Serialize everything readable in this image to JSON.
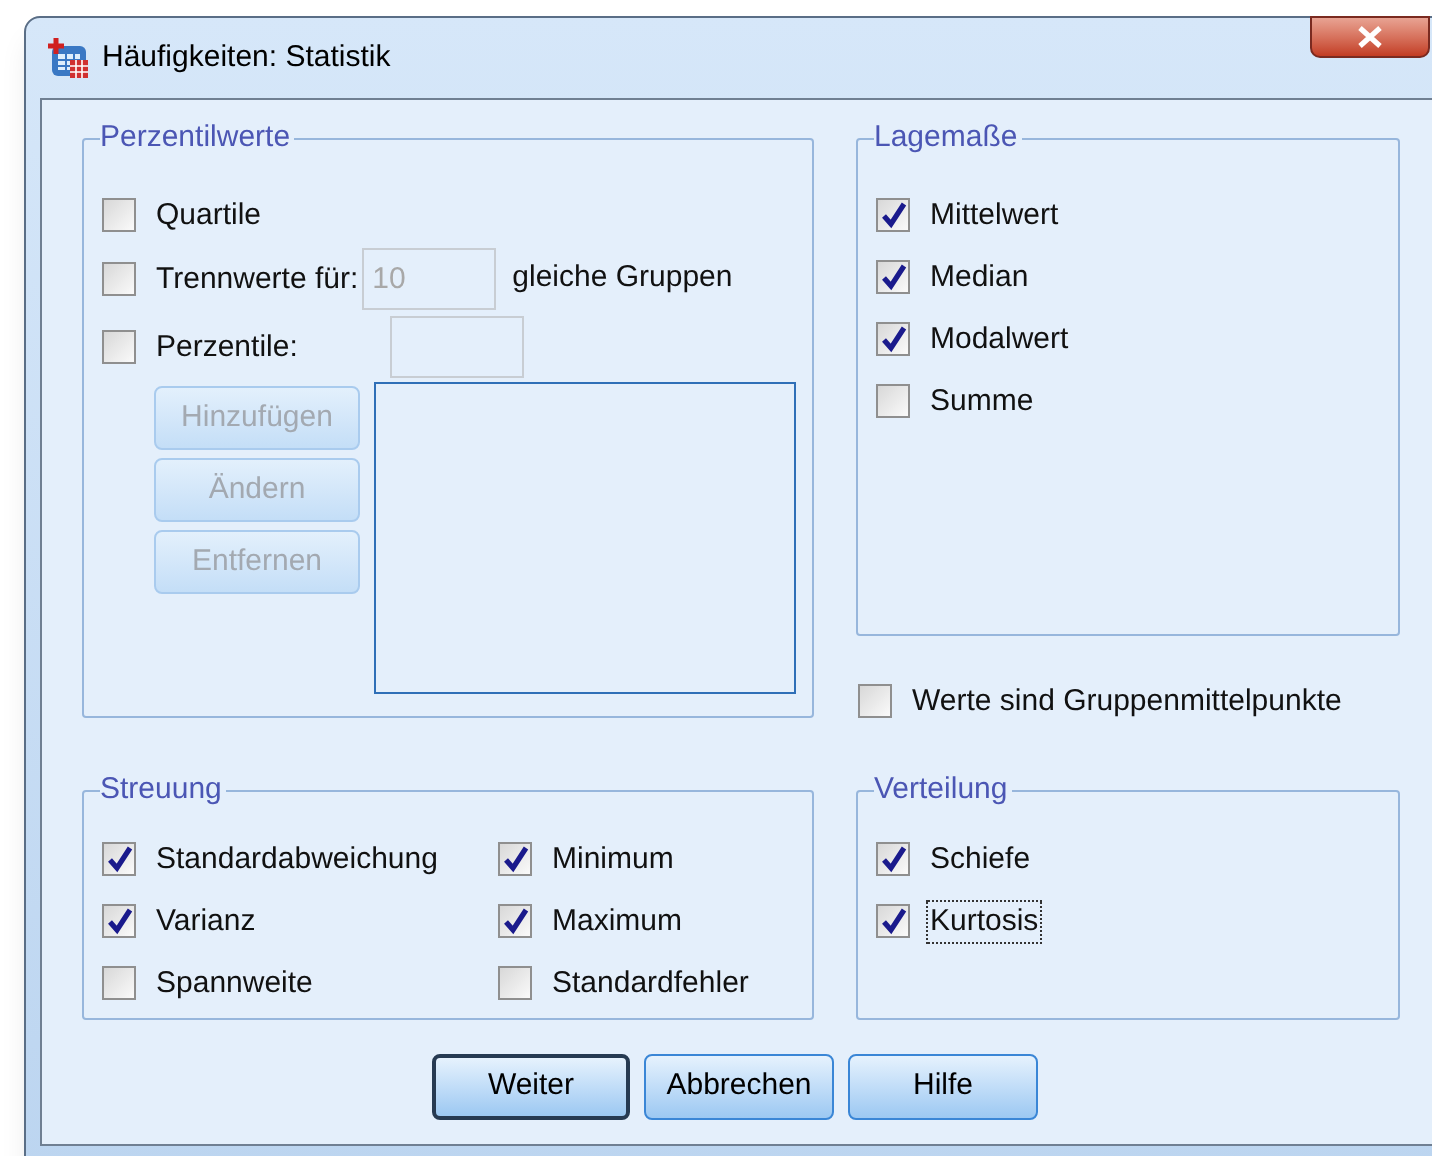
{
  "window": {
    "title": "Häufigkeiten: Statistik"
  },
  "percentiles": {
    "legend": "Perzentilwerte",
    "quartiles": {
      "label": "Quartile",
      "checked": false
    },
    "cut_points": {
      "label": "Trennwerte für:",
      "checked": false,
      "value": "10",
      "disabled": true,
      "suffix": "gleiche Gruppen"
    },
    "percentile": {
      "label": "Perzentile:",
      "checked": false,
      "disabled": true
    },
    "buttons": [
      {
        "label": "Hinzufügen",
        "disabled": true
      },
      {
        "label": "Ändern",
        "disabled": true
      },
      {
        "label": "Entfernen",
        "disabled": true
      }
    ]
  },
  "central_tendency": {
    "legend": "Lagemaße",
    "items": [
      {
        "label": "Mittelwert",
        "checked": true
      },
      {
        "label": "Median",
        "checked": true
      },
      {
        "label": "Modalwert",
        "checked": true
      },
      {
        "label": "Summe",
        "checked": false
      }
    ]
  },
  "group_midpoints": {
    "label": "Werte sind Gruppenmittelpunkte",
    "checked": false
  },
  "dispersion": {
    "legend": "Streuung",
    "items": [
      {
        "label": "Standardabweichung",
        "checked": true
      },
      {
        "label": "Minimum",
        "checked": true
      },
      {
        "label": "Varianz",
        "checked": true
      },
      {
        "label": "Maximum",
        "checked": true
      },
      {
        "label": "Spannweite",
        "checked": false
      },
      {
        "label": "Standardfehler",
        "checked": false
      }
    ]
  },
  "distribution": {
    "legend": "Verteilung",
    "items": [
      {
        "label": "Schiefe",
        "checked": true,
        "focused": false
      },
      {
        "label": "Kurtosis",
        "checked": true,
        "focused": true
      }
    ]
  },
  "buttons": [
    {
      "label": "Weiter",
      "default": true
    },
    {
      "label": "Abbrechen",
      "default": false
    },
    {
      "label": "Hilfe",
      "default": false
    }
  ]
}
